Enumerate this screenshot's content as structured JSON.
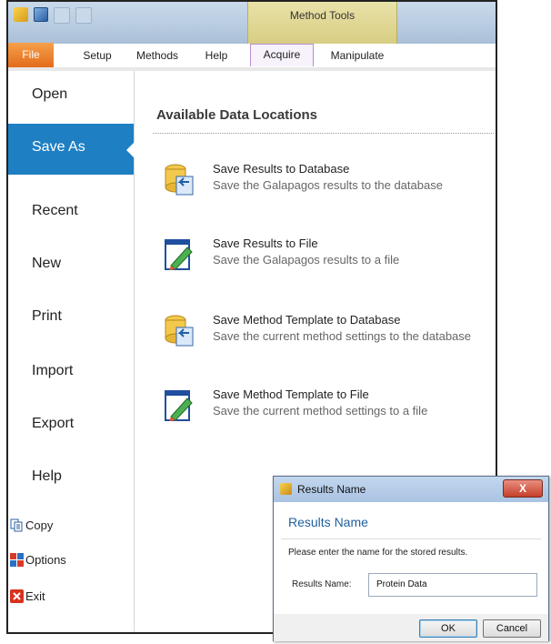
{
  "ribbon": {
    "contextual_group": "Method Tools",
    "tabs": [
      {
        "label": "File"
      },
      {
        "label": "Setup"
      },
      {
        "label": "Methods"
      },
      {
        "label": "Help"
      },
      {
        "label": "Acquire"
      },
      {
        "label": "Manipulate"
      }
    ],
    "colors": {
      "file_tab": "#e36b1b",
      "contextual": "#d8cd83",
      "selected_nav": "#1f7fc3"
    }
  },
  "sidebar": {
    "items": [
      {
        "label": "Open"
      },
      {
        "label": "Save As"
      },
      {
        "label": "Recent"
      },
      {
        "label": "New"
      },
      {
        "label": "Print"
      },
      {
        "label": "Import"
      },
      {
        "label": "Export"
      },
      {
        "label": "Help"
      }
    ],
    "selected": "Save As",
    "small_items": [
      {
        "label": "Copy",
        "icon": "copy-icon"
      },
      {
        "label": "Options",
        "icon": "options-icon"
      },
      {
        "label": "Exit",
        "icon": "exit-icon"
      }
    ]
  },
  "main": {
    "header": "Available Data Locations",
    "options": [
      {
        "title": "Save Results to Database",
        "description": "Save the Galapagos results to the database",
        "icon": "database-icon"
      },
      {
        "title": "Save Results to File",
        "description": "Save the Galapagos results to a file",
        "icon": "file-edit-icon"
      },
      {
        "title": "Save Method Template to Database",
        "description": "Save the current method settings to the database",
        "icon": "database-icon"
      },
      {
        "title": "Save Method Template to File",
        "description": "Save the current method settings to a file",
        "icon": "file-edit-icon"
      }
    ]
  },
  "dialog": {
    "title": "Results Name",
    "close_label": "X",
    "heading": "Results Name",
    "prompt": "Please enter the name for the stored results.",
    "field_label": "Results Name:",
    "field_value": "Protein Data",
    "ok_label": "OK",
    "cancel_label": "Cancel"
  }
}
